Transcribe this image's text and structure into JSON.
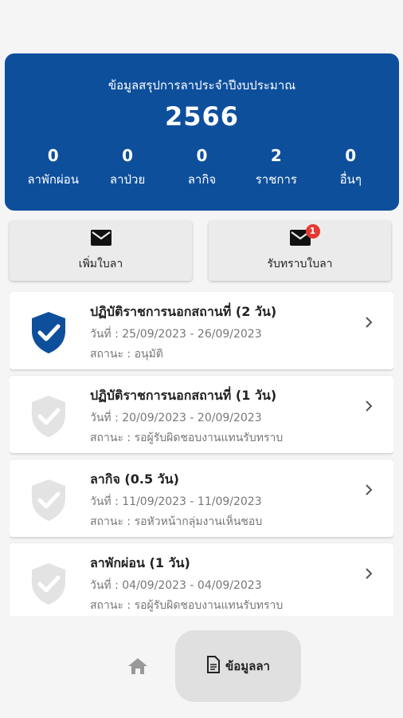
{
  "summary": {
    "title": "ข้อมูลสรุปการลาประจำปีงบประมาณ",
    "year": "2566",
    "stats": [
      {
        "value": "0",
        "label": "ลาพักผ่อน"
      },
      {
        "value": "0",
        "label": "ลาป่วย"
      },
      {
        "value": "0",
        "label": "ลากิจ"
      },
      {
        "value": "2",
        "label": "ราชการ"
      },
      {
        "value": "0",
        "label": "อื่นๆ"
      }
    ]
  },
  "actions": {
    "add_leave_label": "เพิ่มใบลา",
    "acknowledge_label": "รับทราบใบลา",
    "acknowledge_badge": "1"
  },
  "leave_items": [
    {
      "title": "ปฏิบัติราชการนอกสถานที่ (2 วัน)",
      "date": "วันที่ : 25/09/2023 - 26/09/2023",
      "status": "สถานะ : อนุมัติ",
      "approved": true
    },
    {
      "title": "ปฏิบัติราชการนอกสถานที่ (1 วัน)",
      "date": "วันที่ : 20/09/2023 - 20/09/2023",
      "status": "สถานะ : รอผู้รับผิดชอบงานแทนรับทราบ",
      "approved": false
    },
    {
      "title": "ลากิจ (0.5 วัน)",
      "date": "วันที่ : 11/09/2023 - 11/09/2023",
      "status": "สถานะ : รอหัวหน้ากลุ่มงานเห็นชอบ",
      "approved": false
    },
    {
      "title": "ลาพักผ่อน (1 วัน)",
      "date": "วันที่ : 04/09/2023 - 04/09/2023",
      "status": "สถานะ : รอผู้รับผิดชอบงานแทนรับทราบ",
      "approved": false
    }
  ],
  "nav": {
    "home_icon": "home-icon",
    "active_label": "ข้อมูลลา"
  },
  "colors": {
    "brand": "#0e4f9c",
    "approved_shield": "#0e4f9c",
    "pending_shield": "#e3e3e3",
    "badge": "#e53935"
  }
}
